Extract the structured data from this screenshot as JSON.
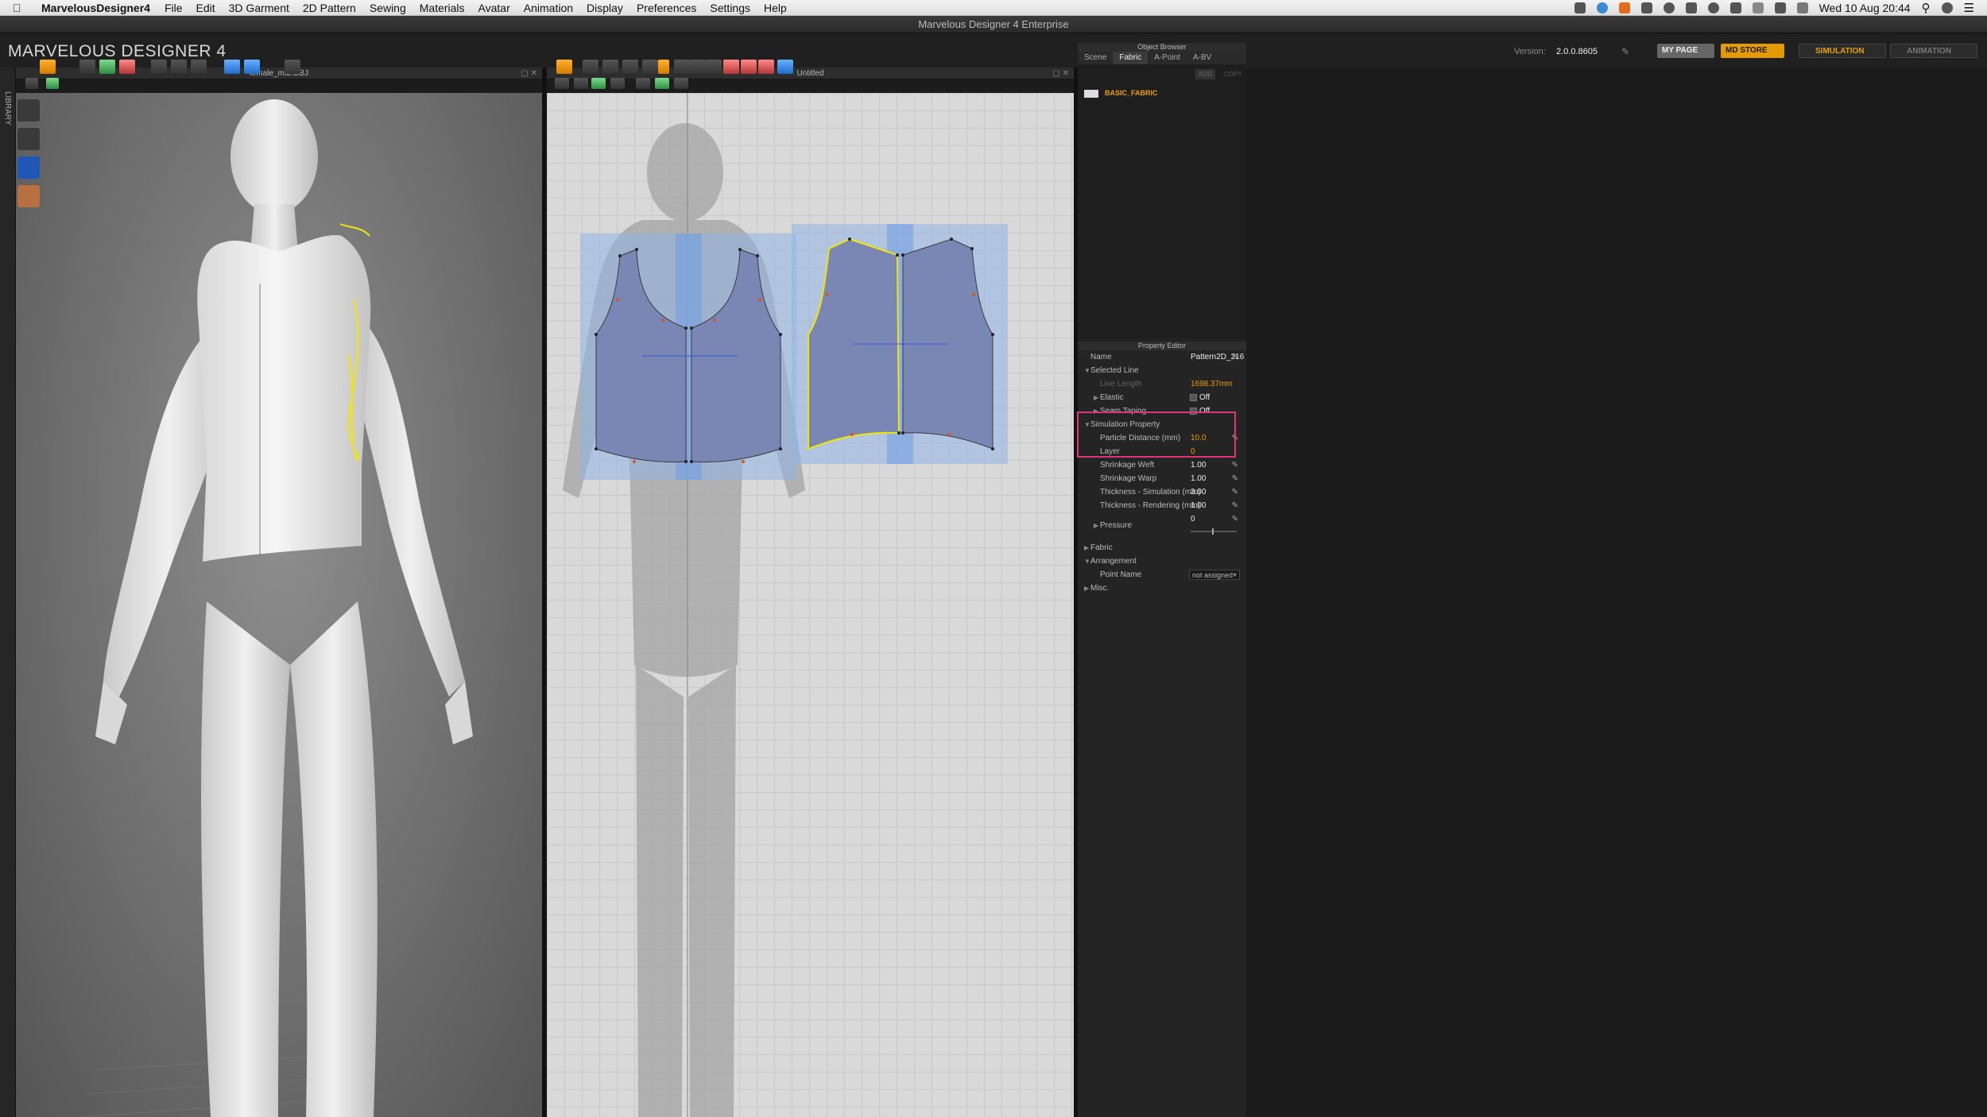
{
  "menubar": {
    "app_name": "MarvelousDesigner4",
    "items": [
      "File",
      "Edit",
      "3D Garment",
      "2D Pattern",
      "Sewing",
      "Materials",
      "Avatar",
      "Animation",
      "Display",
      "Preferences",
      "Settings",
      "Help"
    ],
    "clock": "Wed 10 Aug  20:44"
  },
  "window": {
    "title": "Marvelous Designer 4 Enterprise"
  },
  "header": {
    "app_title": "MARVELOUS DESIGNER 4",
    "version_label": "Version:",
    "version_value": "2.0.0.8605",
    "my_page": "MY PAGE",
    "md_store": "MD STORE",
    "simulation": "SIMULATION",
    "animation": "ANIMATION"
  },
  "library": {
    "label": "LIBRARY"
  },
  "view3d": {
    "title": "female_mid.OBJ"
  },
  "view2d": {
    "title": "Untitled"
  },
  "object_browser": {
    "title": "Object Browser",
    "tabs": [
      "Scene",
      "Fabric",
      "A-Point",
      "A-BV"
    ],
    "active_tab": "Fabric",
    "add": "ADD",
    "copy": "COPY",
    "fabric_item": "BASIC_FABRIC"
  },
  "property_editor": {
    "title": "Property Editor",
    "name_label": "Name",
    "name_value": "Pattern2D_216",
    "selected_line": "Selected Line",
    "line_length_label": "Line Length",
    "line_length_value": "1698.37mm",
    "elastic_label": "Elastic",
    "elastic_value": "Off",
    "seam_taping_label": "Seam Taping",
    "seam_taping_value": "Off",
    "simulation_property": "Simulation Property",
    "particle_distance_label": "Particle Distance (mm)",
    "particle_distance_value": "10.0",
    "layer_label": "Layer",
    "layer_value": "0",
    "shrinkage_weft_label": "Shrinkage Weft",
    "shrinkage_weft_value": "1.00",
    "shrinkage_warp_label": "Shrinkage Warp",
    "shrinkage_warp_value": "1.00",
    "thickness_sim_label": "Thickness - Simulation (mm)",
    "thickness_sim_value": "3.00",
    "thickness_render_label": "Thickness - Rendering (mm)",
    "thickness_render_value": "1.00",
    "pressure_label": "Pressure",
    "pressure_value": "0",
    "fabric": "Fabric",
    "arrangement": "Arrangement",
    "point_name_label": "Point Name",
    "point_name_value": "not assigned",
    "misc": "Misc."
  },
  "colors": {
    "accent": "#e8a000",
    "highlight_box": "#e0357a",
    "selected_line": "#f2e600"
  }
}
